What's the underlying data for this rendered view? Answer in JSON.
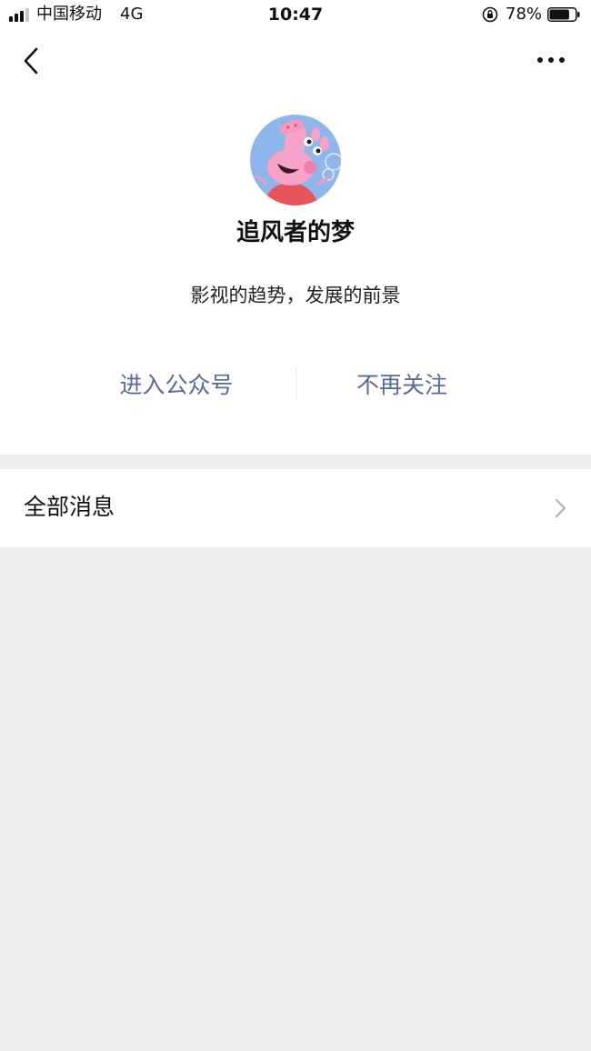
{
  "status_bar": {
    "carrier": "中国移动",
    "network": "4G",
    "time": "10:47",
    "battery_percent": "78%",
    "battery_level": 0.78,
    "signal_bars_active": 3,
    "signal_bars_total": 4
  },
  "header": {
    "back_icon": "chevron-left-icon",
    "more_icon": "more-horizontal-icon"
  },
  "profile": {
    "name": "追风者的梦",
    "description": "影视的趋势，发展的前景",
    "avatar_icon": "cartoon-pig-avatar"
  },
  "actions": {
    "enter_label": "进入公众号",
    "unfollow_label": "不再关注",
    "color": "#576b95"
  },
  "list": {
    "all_messages_label": "全部消息",
    "chevron_icon": "chevron-right-icon"
  },
  "colors": {
    "background": "#ededed",
    "card": "#ffffff",
    "link": "#576b95"
  }
}
